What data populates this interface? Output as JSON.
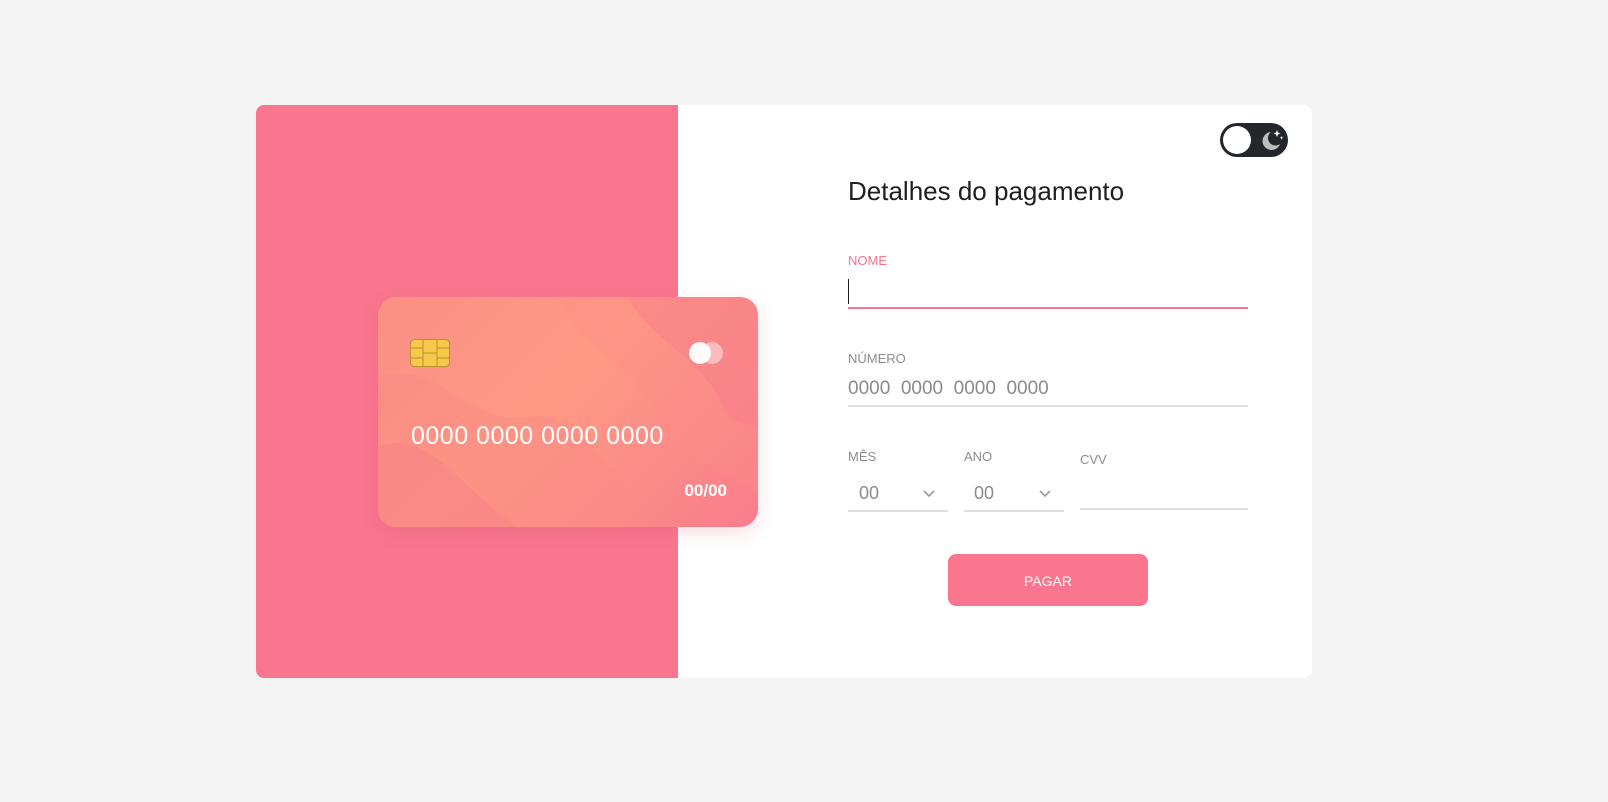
{
  "card": {
    "number": "0000 0000 0000 0000",
    "expiry": "00/00"
  },
  "form": {
    "title": "Detalhes do pagamento",
    "name": {
      "label": "NOME",
      "value": ""
    },
    "number": {
      "label": "NÚMERO",
      "placeholder": "0000  0000  0000  0000"
    },
    "month": {
      "label": "MÊS",
      "value": "00"
    },
    "year": {
      "label": "ANO",
      "value": "00"
    },
    "cvv": {
      "label": "CVV",
      "value": ""
    },
    "submit_label": "PAGAR"
  },
  "theme_toggle": {
    "state": "light",
    "icons": [
      "sun-knob-icon",
      "moon-stars-icon"
    ]
  },
  "colors": {
    "accent": "#f9768e",
    "card_gradient_start": "#fb8f85",
    "card_gradient_end": "#f97c8e",
    "toggle_bg": "#23262b",
    "page_bg": "#f4f4f4"
  }
}
